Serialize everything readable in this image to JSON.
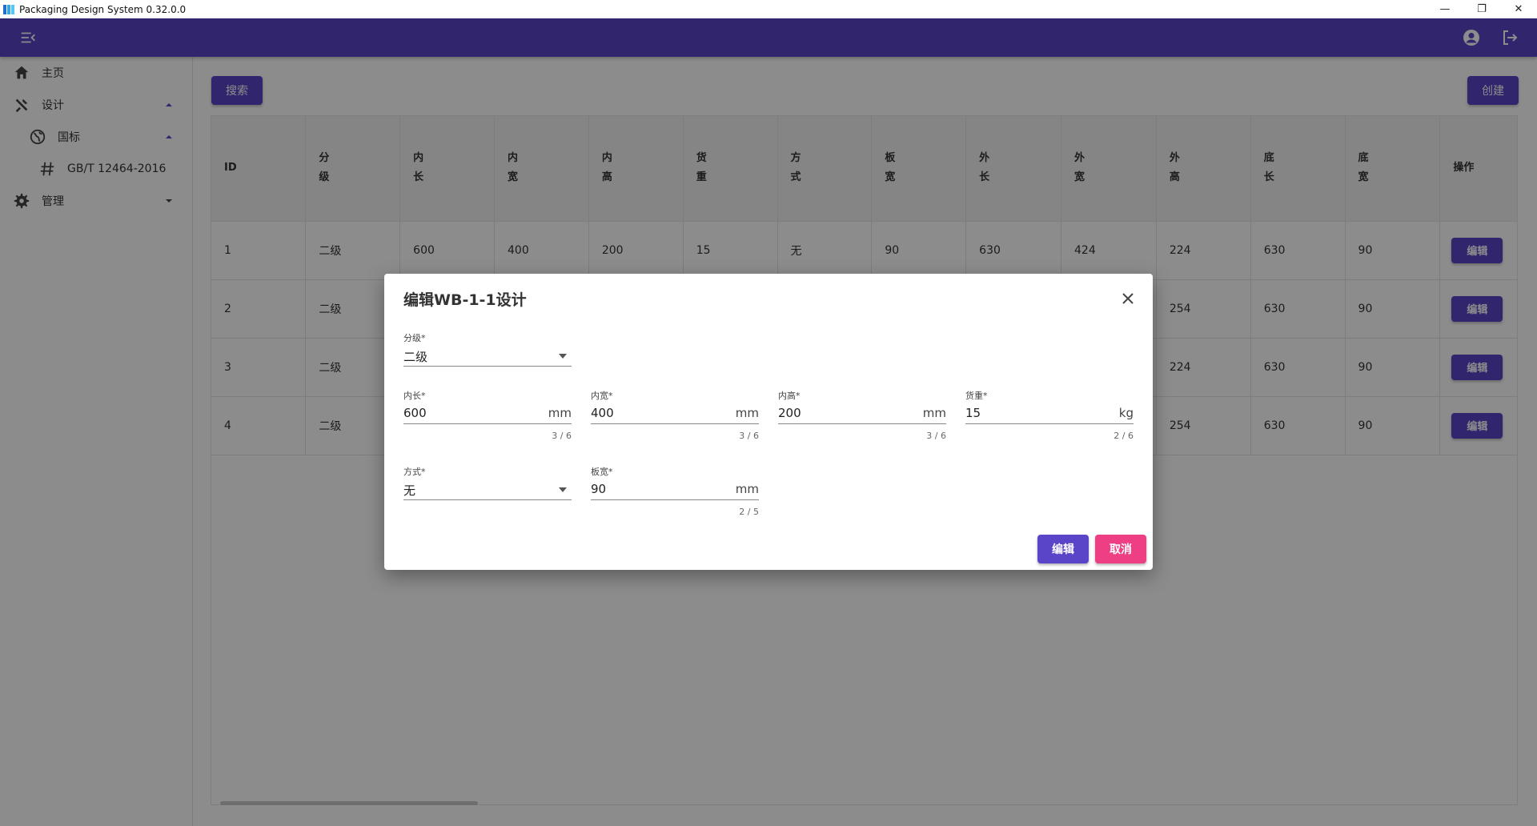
{
  "window": {
    "title": "Packaging Design System 0.32.0.0",
    "controls": {
      "minimize": "—",
      "restore": "❐",
      "close": "✕"
    }
  },
  "colors": {
    "primary": "#5a45c8",
    "danger": "#ee3f84",
    "app_icon": [
      "#1f6fd1",
      "#2fa8e8",
      "#58c6f2"
    ]
  },
  "sidebar": {
    "items": [
      {
        "label": "主页",
        "icon": "home-icon"
      },
      {
        "label": "设计",
        "icon": "tools-icon",
        "expanded": true
      },
      {
        "label": "国标",
        "icon": "globe-icon",
        "expanded": true
      },
      {
        "label": "GB/T 12464-2016",
        "icon": "hash-icon"
      },
      {
        "label": "管理",
        "icon": "gear-icon",
        "expanded": false
      }
    ]
  },
  "toolbar": {
    "search_label": "搜索",
    "create_label": "创建"
  },
  "table": {
    "headers": [
      [
        "ID"
      ],
      [
        "分",
        "级"
      ],
      [
        "内",
        "长"
      ],
      [
        "内",
        "宽"
      ],
      [
        "内",
        "高"
      ],
      [
        "货",
        "重"
      ],
      [
        "方",
        "式"
      ],
      [
        "板",
        "宽"
      ],
      [
        "外",
        "长"
      ],
      [
        "外",
        "宽"
      ],
      [
        "外",
        "高"
      ],
      [
        "底",
        "长"
      ],
      [
        "底",
        "宽"
      ],
      [
        "操作"
      ]
    ],
    "rows": [
      [
        "1",
        "二级",
        "600",
        "400",
        "200",
        "15",
        "无",
        "90",
        "630",
        "424",
        "224",
        "630",
        "90"
      ],
      [
        "2",
        "二级",
        "",
        "",
        "",
        "",
        "",
        "",
        "",
        "",
        "254",
        "630",
        "90"
      ],
      [
        "3",
        "二级",
        "",
        "",
        "",
        "",
        "",
        "",
        "",
        "",
        "224",
        "630",
        "90"
      ],
      [
        "4",
        "二级",
        "",
        "",
        "",
        "",
        "",
        "",
        "",
        "",
        "254",
        "630",
        "90"
      ]
    ],
    "row_action_label": "编辑"
  },
  "dialog": {
    "title": "编辑WB-1-1设计",
    "fields": {
      "grade": {
        "label": "分级*",
        "value": "二级"
      },
      "inner_length": {
        "label": "内长*",
        "value": "600",
        "suffix": "mm",
        "counter": "3 / 6"
      },
      "inner_width": {
        "label": "内宽*",
        "value": "400",
        "suffix": "mm",
        "counter": "3 / 6"
      },
      "inner_height": {
        "label": "内高*",
        "value": "200",
        "suffix": "mm",
        "counter": "3 / 6"
      },
      "cargo_weight": {
        "label": "货重*",
        "value": "15",
        "suffix": "kg",
        "counter": "2 / 6"
      },
      "method": {
        "label": "方式*",
        "value": "无"
      },
      "board_width": {
        "label": "板宽*",
        "value": "90",
        "suffix": "mm",
        "counter": "2 / 5"
      }
    },
    "confirm_label": "编辑",
    "cancel_label": "取消"
  }
}
